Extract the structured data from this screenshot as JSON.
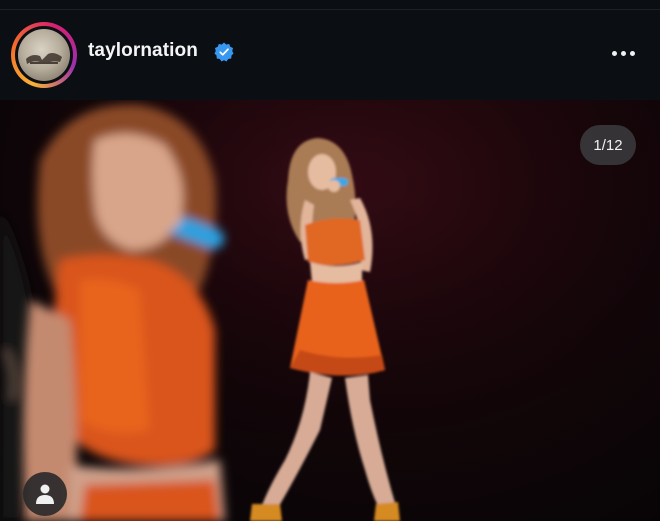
{
  "post": {
    "username": "taylornation",
    "verified": true,
    "more_icon": "more-horizontal-icon",
    "carousel_counter": "1/12",
    "tags_icon": "person-icon"
  },
  "colors": {
    "background": "#0b0e13",
    "verified_badge": "#3897f0",
    "story_ring": [
      "#f9b233",
      "#f36b2b",
      "#d8206f",
      "#9b2fae"
    ]
  }
}
